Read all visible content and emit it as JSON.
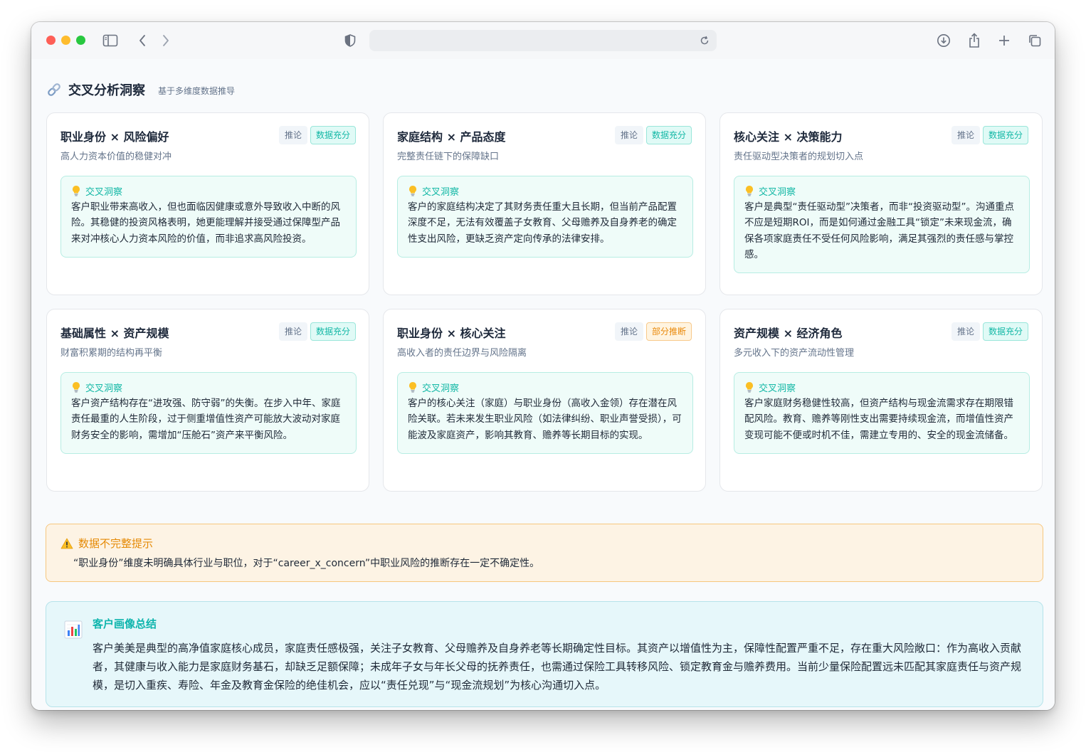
{
  "header": {
    "title": "交叉分析洞察",
    "subtitle": "基于多维度数据推导"
  },
  "cards": [
    {
      "title": "职业身份 × 风险偏好",
      "subtitle": "高人力资本价值的稳健对冲",
      "tag_infer": "推论",
      "tag_status": "数据充分",
      "insight_label": "交叉洞察",
      "insight_text": "客户职业带来高收入，但也面临因健康或意外导致收入中断的风险。其稳健的投资风格表明，她更能理解并接受通过保障型产品来对冲核心人力资本风险的价值，而非追求高风险投资。"
    },
    {
      "title": "家庭结构 × 产品态度",
      "subtitle": "完整责任链下的保障缺口",
      "tag_infer": "推论",
      "tag_status": "数据充分",
      "insight_label": "交叉洞察",
      "insight_text": "客户的家庭结构决定了其财务责任重大且长期，但当前产品配置深度不足，无法有效覆盖子女教育、父母赡养及自身养老的确定性支出风险，更缺乏资产定向传承的法律安排。"
    },
    {
      "title": "核心关注 × 决策能力",
      "subtitle": "责任驱动型决策者的规划切入点",
      "tag_infer": "推论",
      "tag_status": "数据充分",
      "insight_label": "交叉洞察",
      "insight_text": "客户是典型“责任驱动型”决策者，而非“投资驱动型”。沟通重点不应是短期ROI，而是如何通过金融工具“锁定”未来现金流，确保各项家庭责任不受任何风险影响，满足其强烈的责任感与掌控感。"
    },
    {
      "title": "基础属性 × 资产规模",
      "subtitle": "财富积累期的结构再平衡",
      "tag_infer": "推论",
      "tag_status": "数据充分",
      "insight_label": "交叉洞察",
      "insight_text": "客户资产结构存在“进攻强、防守弱”的失衡。在步入中年、家庭责任最重的人生阶段，过于侧重增值性资产可能放大波动对家庭财务安全的影响，需增加“压舱石”资产来平衡风险。"
    },
    {
      "title": "职业身份 × 核心关注",
      "subtitle": "高收入者的责任边界与风险隔离",
      "tag_infer": "推论",
      "tag_status": "部分推断",
      "insight_label": "交叉洞察",
      "insight_text": "客户的核心关注（家庭）与职业身份（高收入金领）存在潜在风险关联。若未来发生职业风险（如法律纠纷、职业声誉受损），可能波及家庭资产，影响其教育、赡养等长期目标的实现。"
    },
    {
      "title": "资产规模 × 经济角色",
      "subtitle": "多元收入下的资产流动性管理",
      "tag_infer": "推论",
      "tag_status": "数据充分",
      "insight_label": "交叉洞察",
      "insight_text": "客户家庭财务稳健性较高，但资产结构与现金流需求存在期限错配风险。教育、赡养等刚性支出需要持续现金流，而增值性资产变现可能不便或时机不佳，需建立专用的、安全的现金流储备。"
    }
  ],
  "warning": {
    "title": "数据不完整提示",
    "text": "“职业身份”维度未明确具体行业与职位，对于“career_x_concern”中职业风险的推断存在一定不确定性。"
  },
  "summary": {
    "title": "客户画像总结",
    "text": "客户美美是典型的高净值家庭核心成员，家庭责任感极强，关注子女教育、父母赡养及自身养老等长期确定性目标。其资产以增值性为主，保障性配置严重不足，存在重大风险敞口：作为高收入贡献者，其健康与收入能力是家庭财务基石，却缺乏足额保障；未成年子女与年长父母的抚养责任，也需通过保险工具转移风险、锁定教育金与赡养费用。当前少量保险配置远未匹配其家庭责任与资产规模，是切入重疾、寿险、年金及教育金保险的绝佳机会，应以“责任兑现”与“现金流规划”为核心沟通切入点。"
  },
  "colors": {
    "accent_teal": "#14b8a6",
    "warning_orange": "#e58a06"
  }
}
